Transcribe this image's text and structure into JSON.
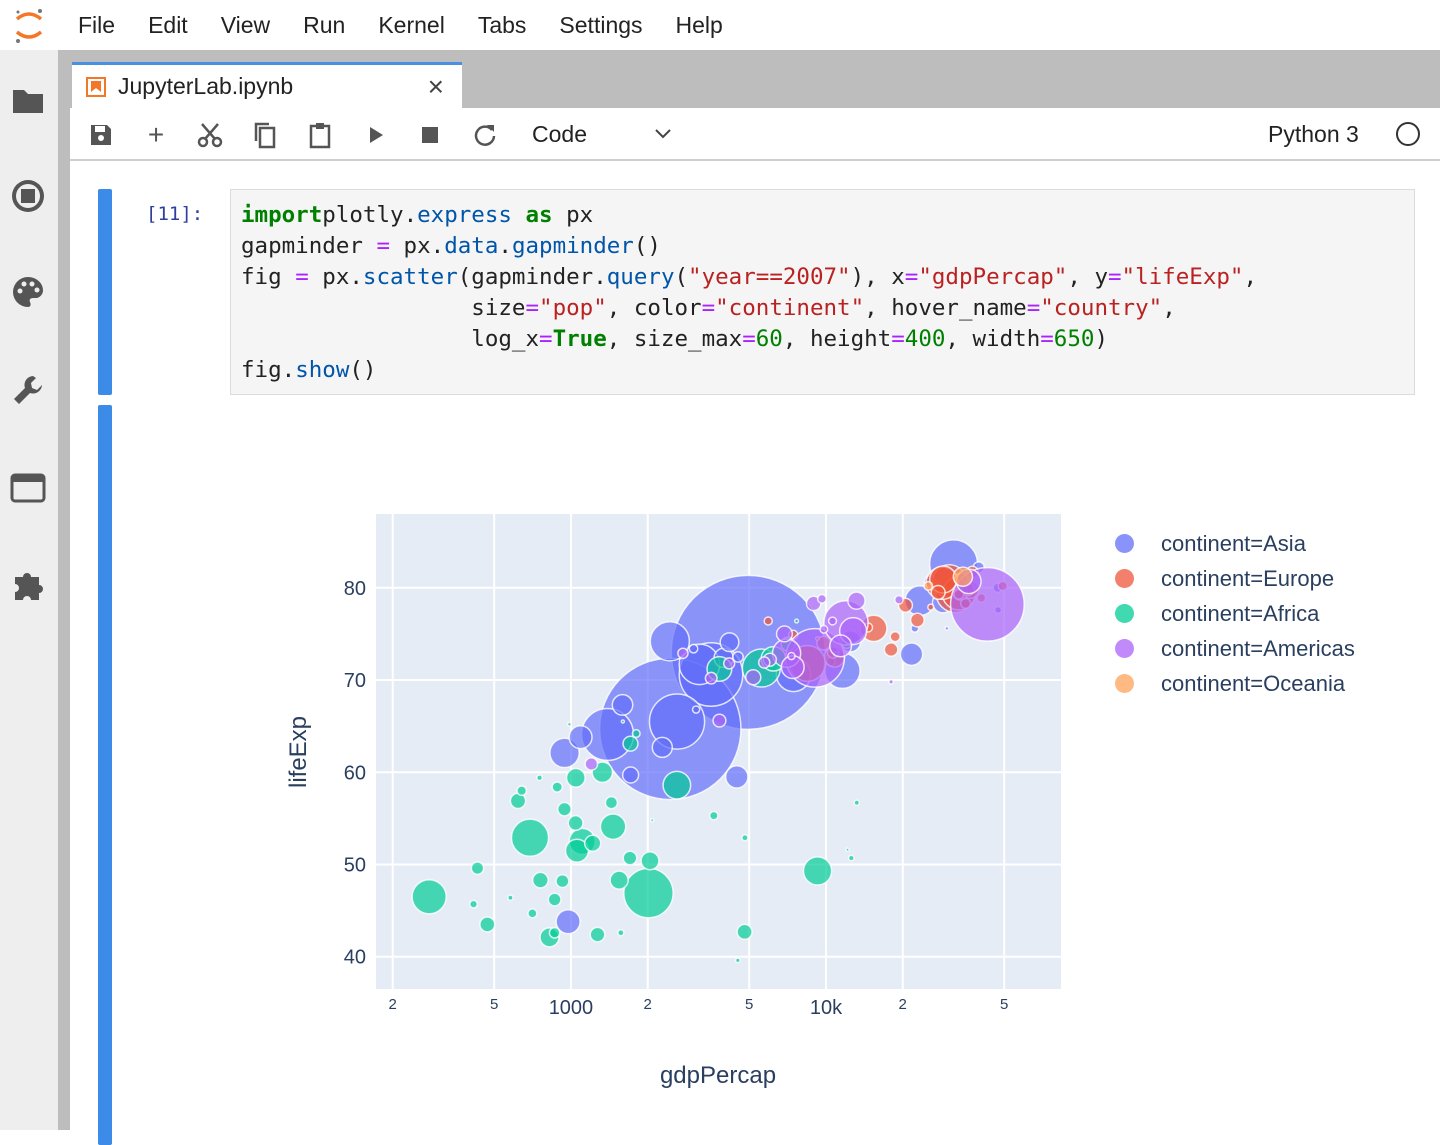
{
  "menu": [
    "File",
    "Edit",
    "View",
    "Run",
    "Kernel",
    "Tabs",
    "Settings",
    "Help"
  ],
  "tab": {
    "title": "JupyterLab.ipynb"
  },
  "toolbar": {
    "cell_type": "Code",
    "kernel": "Python 3"
  },
  "cell": {
    "prompt": "[11]:",
    "lines": [
      [
        [
          "k",
          "import"
        ],
        [
          "",
          "plotly"
        ],
        [
          "",
          "."
        ],
        [
          "a",
          "express"
        ],
        [
          "",
          " "
        ],
        [
          "k",
          "as"
        ],
        [
          "",
          " px"
        ]
      ],
      [
        [
          "",
          "gapminder "
        ],
        [
          "o",
          "="
        ],
        [
          "",
          " px."
        ],
        [
          "a",
          "data"
        ],
        [
          "",
          "."
        ],
        [
          "a",
          "gapminder"
        ],
        [
          "",
          "()"
        ]
      ],
      [
        [
          "",
          "fig "
        ],
        [
          "o",
          "="
        ],
        [
          "",
          " px."
        ],
        [
          "a",
          "scatter"
        ],
        [
          "",
          "(gapminder."
        ],
        [
          "a",
          "query"
        ],
        [
          "",
          "("
        ],
        [
          "s",
          "\"year==2007\""
        ],
        [
          "",
          "), x"
        ],
        [
          "o",
          "="
        ],
        [
          "s",
          "\"gdpPercap\""
        ],
        [
          "",
          ", y"
        ],
        [
          "o",
          "="
        ],
        [
          "s",
          "\"lifeExp\""
        ],
        [
          "",
          ","
        ]
      ],
      [
        [
          "",
          "                 size"
        ],
        [
          "o",
          "="
        ],
        [
          "s",
          "\"pop\""
        ],
        [
          "",
          ", color"
        ],
        [
          "o",
          "="
        ],
        [
          "s",
          "\"continent\""
        ],
        [
          "",
          ", hover_name"
        ],
        [
          "o",
          "="
        ],
        [
          "s",
          "\"country\""
        ],
        [
          "",
          ","
        ]
      ],
      [
        [
          "",
          "                 log_x"
        ],
        [
          "o",
          "="
        ],
        [
          "k",
          "True"
        ],
        [
          "",
          ", size_max"
        ],
        [
          "o",
          "="
        ],
        [
          "n",
          "60"
        ],
        [
          "",
          ", height"
        ],
        [
          "o",
          "="
        ],
        [
          "n",
          "400"
        ],
        [
          "",
          ", width"
        ],
        [
          "o",
          "="
        ],
        [
          "n",
          "650"
        ],
        [
          "",
          ")"
        ]
      ],
      [
        [
          "",
          "fig."
        ],
        [
          "a",
          "show"
        ],
        [
          "",
          "()"
        ]
      ]
    ]
  },
  "chart_data": {
    "type": "scatter",
    "xlabel": "gdpPercap",
    "ylabel": "lifeExp",
    "xscale": "log",
    "xlim": [
      172,
      83500
    ],
    "ylim": [
      36.5,
      88
    ],
    "xticks": [
      {
        "v": 200,
        "l": "2"
      },
      {
        "v": 500,
        "l": "5"
      },
      {
        "v": 1000,
        "l": "1000"
      },
      {
        "v": 2000,
        "l": "2"
      },
      {
        "v": 5000,
        "l": "5"
      },
      {
        "v": 10000,
        "l": "10k"
      },
      {
        "v": 20000,
        "l": "2"
      },
      {
        "v": 50000,
        "l": "5"
      }
    ],
    "yticks": [
      40,
      50,
      60,
      70,
      80
    ],
    "size_field": "pop (millions)",
    "size_max": 60,
    "series": [
      {
        "name": "continent=Asia",
        "color": "#636efa",
        "points": [
          [
            4959,
            73.0,
            1318
          ],
          [
            2452,
            64.7,
            1110
          ],
          [
            3541,
            70.6,
            224
          ],
          [
            2606,
            65.5,
            169
          ],
          [
            1391,
            64.1,
            150
          ],
          [
            31656,
            82.6,
            127
          ],
          [
            3190,
            71.7,
            91
          ],
          [
            2442,
            74.2,
            85
          ],
          [
            11606,
            71.0,
            69
          ],
          [
            7458,
            70.6,
            65
          ],
          [
            944,
            62.1,
            47.8
          ],
          [
            23348,
            78.6,
            49
          ],
          [
            975,
            43.8,
            31.9
          ],
          [
            1091,
            63.8,
            28.9
          ],
          [
            4471,
            59.5,
            27.5
          ],
          [
            21655,
            72.8,
            27.6
          ],
          [
            12452,
            74.2,
            24.8
          ],
          [
            1593,
            67.3,
            23.3
          ],
          [
            28718,
            78.4,
            23.2
          ],
          [
            3970,
            72.4,
            20.4
          ],
          [
            2281,
            62.7,
            22.2
          ],
          [
            4185,
            74.1,
            19.3
          ],
          [
            1714,
            59.7,
            14.1
          ],
          [
            39725,
            82.2,
            6.98
          ],
          [
            25523,
            80.7,
            6.4
          ],
          [
            4519,
            72.5,
            6.05
          ],
          [
            10461,
            72.0,
            3.9
          ],
          [
            47143,
            80.0,
            4.55
          ],
          [
            3096,
            66.8,
            2.87
          ],
          [
            47307,
            77.6,
            2.5
          ],
          [
            22316,
            75.6,
            3.2
          ],
          [
            3025,
            73.4,
            4.0
          ],
          [
            29796,
            75.6,
            0.7
          ]
        ]
      },
      {
        "name": "continent=Europe",
        "color": "#EF553B",
        "points": [
          [
            32170,
            79.4,
            82.4
          ],
          [
            8458,
            71.8,
            71.2
          ],
          [
            30470,
            80.7,
            61.1
          ],
          [
            33203,
            79.4,
            60.8
          ],
          [
            28570,
            80.5,
            58.1
          ],
          [
            28821,
            80.9,
            40.4
          ],
          [
            15390,
            75.6,
            38.5
          ],
          [
            10808,
            72.5,
            22.3
          ],
          [
            36798,
            79.8,
            16.6
          ],
          [
            27538,
            79.5,
            10.7
          ],
          [
            20510,
            78.1,
            10.6
          ],
          [
            33693,
            79.4,
            10.4
          ],
          [
            22833,
            76.5,
            10.2
          ],
          [
            18009,
            73.3,
            9.96
          ],
          [
            33860,
            80.9,
            9.03
          ],
          [
            36126,
            79.8,
            8.2
          ],
          [
            9787,
            74.0,
            10.2
          ],
          [
            10681,
            73.0,
            7.3
          ],
          [
            37506,
            81.7,
            7.55
          ],
          [
            35278,
            78.3,
            5.47
          ],
          [
            18678,
            74.7,
            5.45
          ],
          [
            33207,
            79.3,
            5.24
          ],
          [
            49357,
            80.2,
            4.63
          ],
          [
            14619,
            75.7,
            4.49
          ],
          [
            40676,
            78.9,
            4.11
          ],
          [
            7446,
            74.9,
            4.55
          ],
          [
            5937,
            76.4,
            3.6
          ],
          [
            25768,
            77.9,
            2.0
          ],
          [
            9254,
            74.5,
            0.68
          ],
          [
            36181,
            81.8,
            0.3
          ]
        ]
      },
      {
        "name": "continent=Africa",
        "color": "#00cc96",
        "points": [
          [
            2014,
            46.9,
            135
          ],
          [
            691,
            52.9,
            76.5
          ],
          [
            5581,
            71.3,
            80.3
          ],
          [
            278,
            46.5,
            64.6
          ],
          [
            9270,
            49.3,
            44
          ],
          [
            2602,
            58.6,
            42.3
          ],
          [
            1107,
            52.5,
            38.1
          ],
          [
            1463,
            54.1,
            35.6
          ],
          [
            3820,
            71.2,
            33.8
          ],
          [
            6223,
            72.3,
            33.3
          ],
          [
            1056,
            51.5,
            29.2
          ],
          [
            1328,
            60.0,
            22.9
          ],
          [
            824,
            42.1,
            20
          ],
          [
            1045,
            59.4,
            19.2
          ],
          [
            1545,
            48.3,
            18
          ],
          [
            2042,
            50.4,
            17.7
          ],
          [
            4797,
            42.7,
            12.4
          ],
          [
            1217,
            52.3,
            14.3
          ],
          [
            759,
            48.3,
            13.3
          ],
          [
            620,
            56.9,
            12.9
          ],
          [
            1043,
            54.5,
            12
          ],
          [
            1712,
            63.1,
            12.3
          ],
          [
            1271,
            42.4,
            11.7
          ],
          [
            470,
            43.5,
            12.3
          ],
          [
            1704,
            50.7,
            10.2
          ],
          [
            7093,
            73.9,
            10.3
          ],
          [
            943,
            56.0,
            9.9
          ],
          [
            863,
            46.2,
            8.86
          ],
          [
            926,
            48.2,
            9.1
          ],
          [
            430,
            49.6,
            8.4
          ],
          [
            1441,
            56.7,
            8.1
          ],
          [
            863,
            42.6,
            6.1
          ],
          [
            883,
            58.4,
            5.7
          ],
          [
            12057,
            74.0,
            6.0
          ],
          [
            641,
            58.0,
            4.9
          ],
          [
            706,
            44.7,
            4.4
          ],
          [
            415,
            45.7,
            3.2
          ],
          [
            1803,
            64.2,
            3.3
          ],
          [
            3633,
            55.3,
            3.8
          ],
          [
            4811,
            52.9,
            2.06
          ],
          [
            12570,
            50.7,
            1.64
          ],
          [
            1569,
            42.6,
            2.0
          ],
          [
            13206,
            56.7,
            1.45
          ],
          [
            753,
            59.4,
            1.7
          ],
          [
            579,
            46.4,
            1.47
          ],
          [
            10957,
            72.8,
            1.25
          ],
          [
            4513,
            39.6,
            1.13
          ],
          [
            2082,
            54.8,
            0.5
          ],
          [
            986,
            65.2,
            0.7
          ],
          [
            12154,
            51.6,
            0.55
          ],
          [
            7670,
            76.4,
            0.8
          ],
          [
            1598,
            65.5,
            0.2
          ]
        ]
      },
      {
        "name": "continent=Americas",
        "color": "#ab63fa",
        "points": [
          [
            42952,
            78.2,
            301
          ],
          [
            9066,
            72.4,
            190
          ],
          [
            11978,
            76.2,
            108.7
          ],
          [
            7007,
            72.9,
            44.2
          ],
          [
            12779,
            75.3,
            40.3
          ],
          [
            36319,
            80.7,
            33.4
          ],
          [
            7409,
            71.4,
            28.7
          ],
          [
            11416,
            73.7,
            26.1
          ],
          [
            13172,
            78.6,
            16.3
          ],
          [
            6873,
            75.0,
            13.8
          ],
          [
            5186,
            70.3,
            12.6
          ],
          [
            8948,
            78.3,
            11.4
          ],
          [
            1202,
            60.9,
            8.5
          ],
          [
            3822,
            65.6,
            9.1
          ],
          [
            6025,
            72.2,
            9.3
          ],
          [
            3548,
            70.2,
            7.5
          ],
          [
            5728,
            71.9,
            6.9
          ],
          [
            4173,
            71.8,
            6.7
          ],
          [
            2749,
            72.9,
            5.7
          ],
          [
            9645,
            78.8,
            4.1
          ],
          [
            19329,
            78.7,
            3.9
          ],
          [
            10611,
            76.4,
            3.4
          ],
          [
            9809,
            75.5,
            3.2
          ],
          [
            7321,
            72.6,
            2.8
          ],
          [
            18008,
            69.8,
            1.06
          ]
        ]
      },
      {
        "name": "continent=Oceania",
        "color": "#FFA15A",
        "points": [
          [
            34435,
            81.2,
            20.4
          ],
          [
            25185,
            80.2,
            4.1
          ]
        ]
      }
    ]
  }
}
